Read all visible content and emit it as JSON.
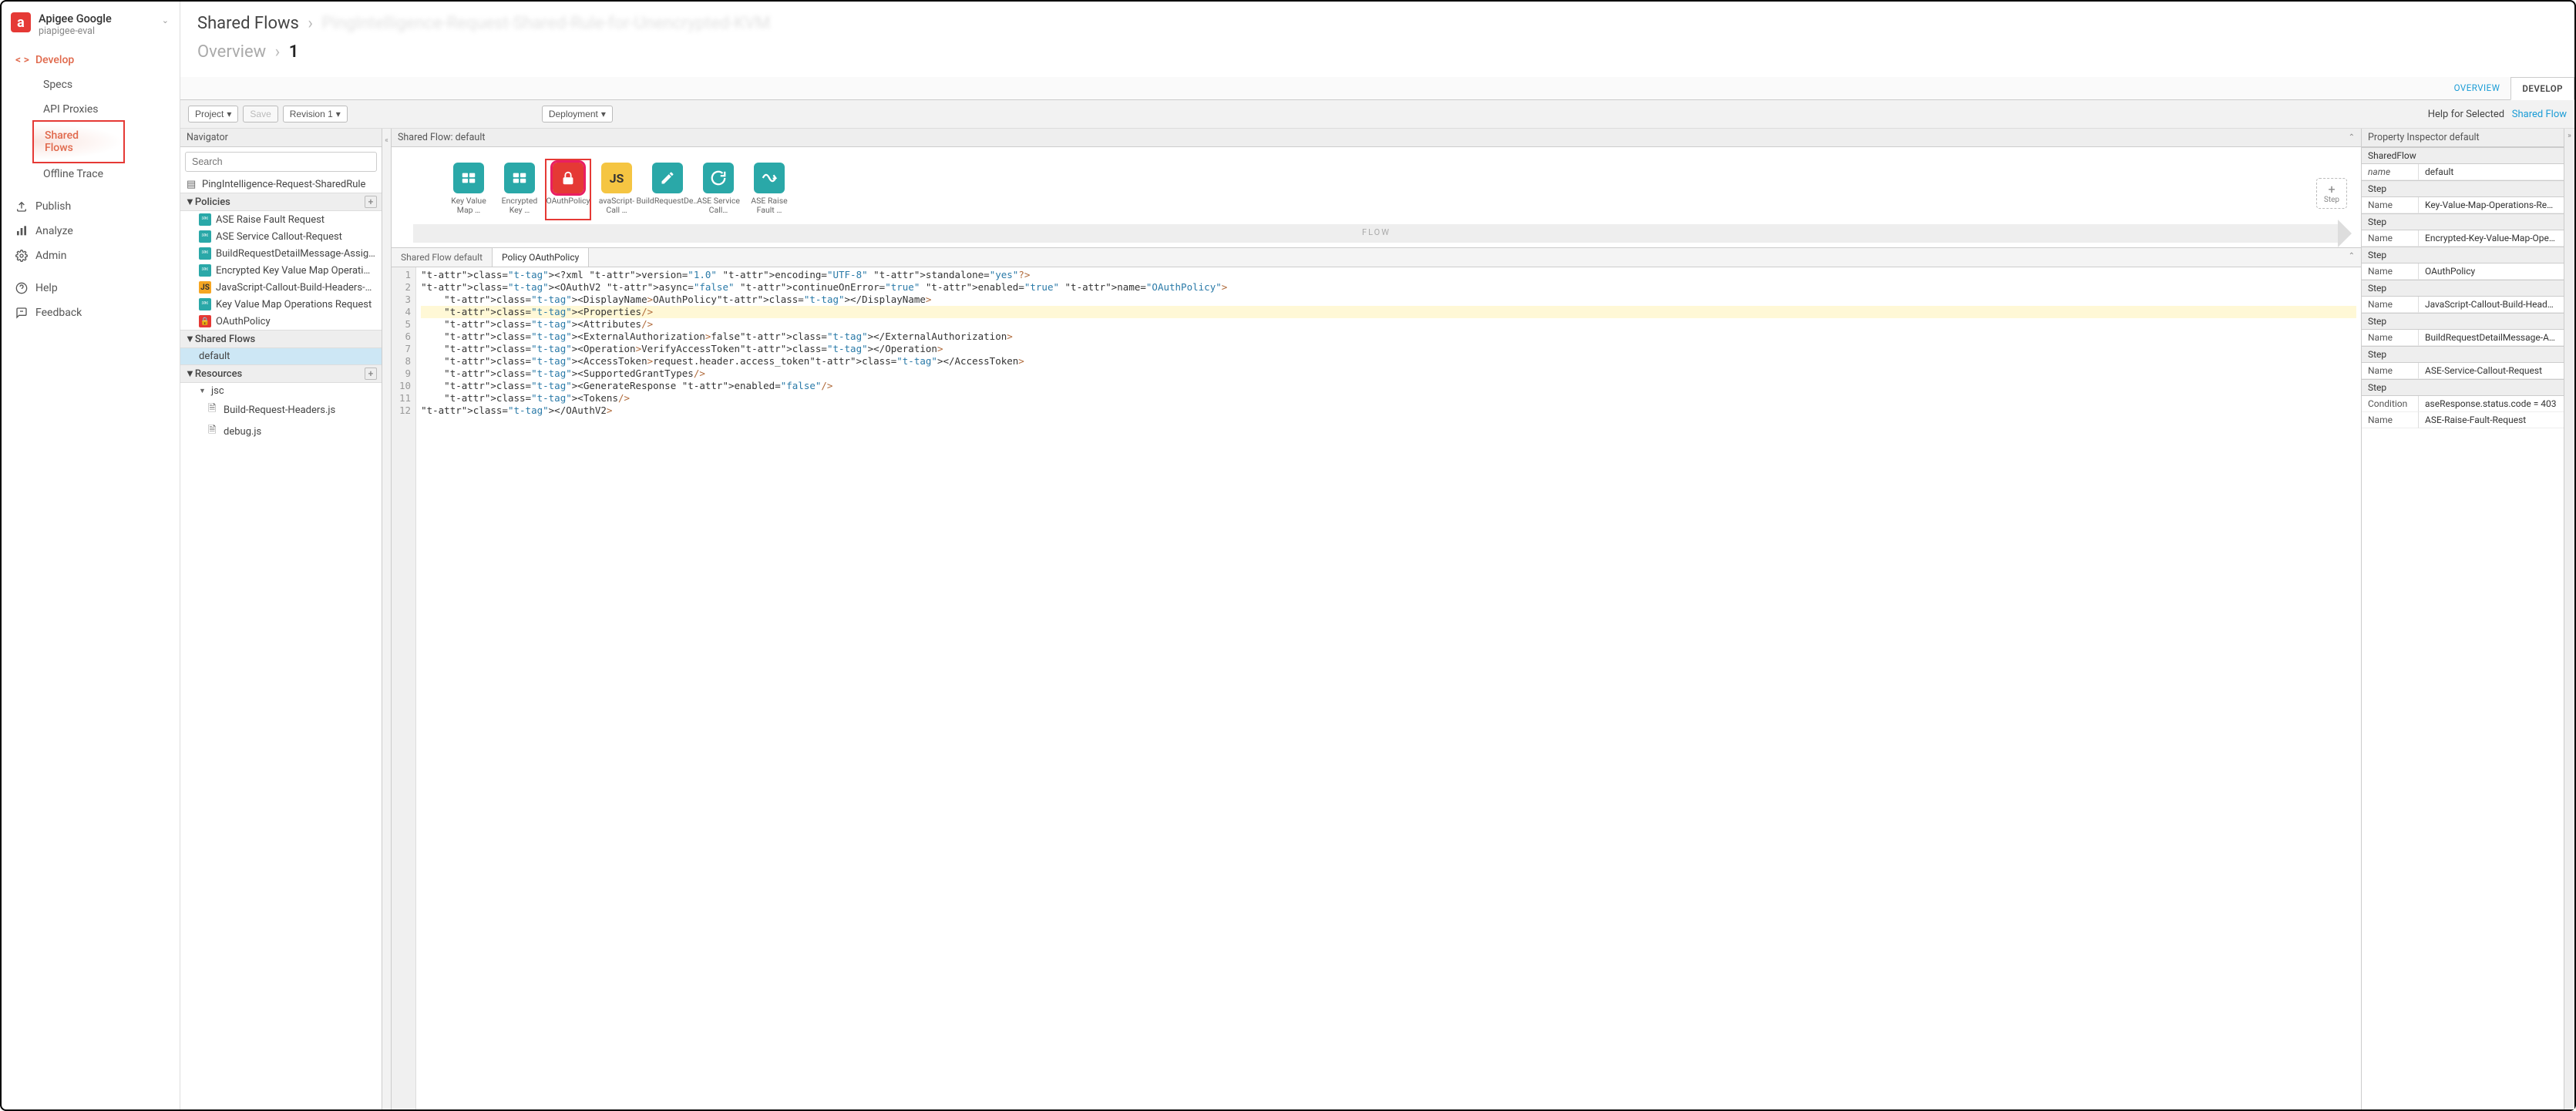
{
  "org": {
    "name": "Apigee Google",
    "env": "piapigee-eval"
  },
  "sidebar": {
    "develop": "Develop",
    "items": [
      "Specs",
      "API Proxies",
      "Shared Flows",
      "Offline Trace"
    ],
    "publish": "Publish",
    "analyze": "Analyze",
    "admin": "Admin",
    "help": "Help",
    "feedback": "Feedback"
  },
  "breadcrumb": {
    "root": "Shared Flows",
    "leaf_hidden": "PingIntelligence-Request-Shared-Rule-for-Unencrypted-KVM"
  },
  "breadcrumb2": {
    "root": "Overview",
    "leaf": "1"
  },
  "tabs": {
    "overview": "OVERVIEW",
    "develop": "DEVELOP"
  },
  "toolbar": {
    "project": "Project",
    "save": "Save",
    "revision": "Revision 1",
    "deployment": "Deployment",
    "help_prefix": "Help for Selected",
    "help_link": "Shared Flow"
  },
  "navigator": {
    "title": "Navigator",
    "search_placeholder": "Search",
    "root": "PingIntelligence-Request-SharedRule",
    "policies_header": "Policies",
    "policies": [
      {
        "icon": "teal",
        "label": "ASE Raise Fault Request"
      },
      {
        "icon": "teal",
        "label": "ASE Service Callout-Request"
      },
      {
        "icon": "teal",
        "label": "BuildRequestDetailMessage-Assig…"
      },
      {
        "icon": "teal",
        "label": "Encrypted Key Value Map Operati…"
      },
      {
        "icon": "yellow",
        "label": "JavaScript-Callout-Build-Headers-…"
      },
      {
        "icon": "teal",
        "label": "Key Value Map Operations Request"
      },
      {
        "icon": "red",
        "label": "OAuthPolicy"
      }
    ],
    "sharedflows_header": "Shared Flows",
    "sharedflows": [
      "default"
    ],
    "resources_header": "Resources",
    "jsc": "jsc",
    "resources": [
      "Build-Request-Headers.js",
      "debug.js"
    ]
  },
  "canvas": {
    "title": "Shared Flow: default",
    "cards": [
      {
        "color": "teal",
        "icon": "kvm",
        "label": "Key Value Map …"
      },
      {
        "color": "teal",
        "icon": "kvm",
        "label": "Encrypted Key …"
      },
      {
        "color": "red",
        "icon": "lock",
        "label": "OAuthPolicy",
        "selected": true
      },
      {
        "color": "yellow",
        "icon": "js",
        "label": "avaScript-Call …"
      },
      {
        "color": "teal",
        "icon": "edit",
        "label": "BuildRequestDe…"
      },
      {
        "color": "teal",
        "icon": "cloud",
        "label": "ASE Service Call…"
      },
      {
        "color": "teal",
        "icon": "fault",
        "label": "ASE Raise Fault …"
      }
    ],
    "flow_label": "FLOW",
    "add_step": "Step"
  },
  "editor": {
    "tabs": [
      "Shared Flow default",
      "Policy OAuthPolicy"
    ],
    "active": 1,
    "code_lines": [
      "<?xml version=\"1.0\" encoding=\"UTF-8\" standalone=\"yes\"?>",
      "<OAuthV2 async=\"false\" continueOnError=\"true\" enabled=\"true\" name=\"OAuthPolicy\">",
      "    <DisplayName>OAuthPolicy</DisplayName>",
      "    <Properties/>",
      "    <Attributes/>",
      "    <ExternalAuthorization>false</ExternalAuthorization>",
      "    <Operation>VerifyAccessToken</Operation>",
      "    <AccessToken>request.header.access_token</AccessToken>",
      "    <SupportedGrantTypes/>",
      "    <GenerateResponse enabled=\"false\"/>",
      "    <Tokens/>",
      "</OAuthV2>"
    ],
    "highlighted_line": 4
  },
  "inspector": {
    "title": "Property Inspector  default",
    "section0": "SharedFlow",
    "name_key": "name",
    "name_val": "default",
    "step_label": "Step",
    "nm_label": "Name",
    "cond_label": "Condition",
    "steps": [
      {
        "name": "Key-Value-Map-Operations-Request"
      },
      {
        "name": "Encrypted-Key-Value-Map-Operations"
      },
      {
        "name": "OAuthPolicy"
      },
      {
        "name": "JavaScript-Callout-Build-Headers-Cookies"
      },
      {
        "name": "BuildRequestDetailMessage-AssignMessage"
      },
      {
        "name": "ASE-Service-Callout-Request"
      },
      {
        "name": "ASE-Raise-Fault-Request",
        "condition": "aseResponse.status.code = 403"
      }
    ]
  }
}
